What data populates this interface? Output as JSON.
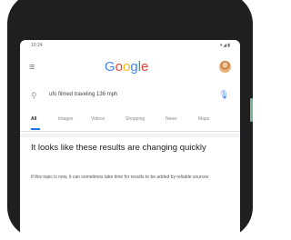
{
  "status_bar": {
    "time": "10:24",
    "icons": "▾◢▮"
  },
  "header": {
    "logo_letters": [
      "G",
      "o",
      "o",
      "g",
      "l",
      "e"
    ],
    "logo_colors": [
      "#4285f4",
      "#ea4335",
      "#fbbc05",
      "#4285f4",
      "#34a853",
      "#ea4335"
    ]
  },
  "search": {
    "query": "ufo filmed traveling 136 mph"
  },
  "tabs": [
    {
      "label": "All"
    },
    {
      "label": "Images"
    },
    {
      "label": "Videos"
    },
    {
      "label": "Shopping"
    },
    {
      "label": "News"
    },
    {
      "label": "Maps"
    }
  ],
  "notice": {
    "headline": "It looks like these results are changing quickly",
    "body": "If this topic is new, it can sometimes take time for results to be added by reliable sources"
  },
  "colors": {
    "tab_accent": "#1a73e8",
    "phone_frame": "#1f1f1f"
  }
}
